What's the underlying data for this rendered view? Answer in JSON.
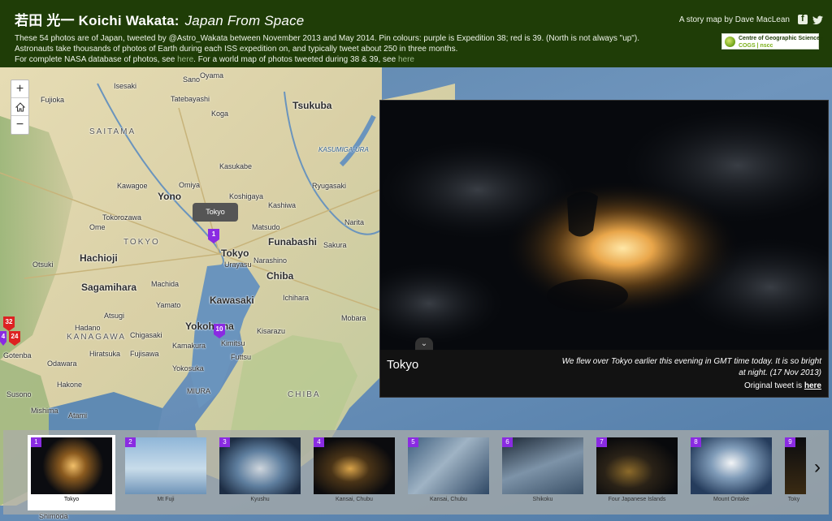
{
  "header": {
    "title_main": "若田 光一 Koichi Wakata:",
    "title_italic": "Japan From Space",
    "description": {
      "line1": "These 54 photos are of Japan, tweeted by @Astro_Wakata between November 2013 and May 2014. Pin colours: purple is Expedition 38; red is 39. (North is not always \"up\").",
      "line2": "Astronauts take thousands of photos of Earth during each ISS expedition on, and typically tweet about 250 in three months.",
      "line3_a": "For complete NASA database of photos, see",
      "line3_link1": "here",
      "line3_b": ". For a world map of photos tweeted during 38 & 39, see",
      "line3_link2": "here"
    },
    "byline": "A story map by Dave MacLean",
    "logo_line1": "Centre of Geographic Sciences",
    "logo_line2": "COGS | nscc"
  },
  "map": {
    "zoom_in": "+",
    "zoom_out": "−",
    "home_icon": "home-icon",
    "tooltip": "Tokyo",
    "labels": [
      {
        "text": "Oyama",
        "cls": ""
      },
      {
        "text": "Tsukuba",
        "cls": ""
      },
      {
        "text": "Koga",
        "cls": ""
      },
      {
        "text": "SAITAMA",
        "cls": "region"
      },
      {
        "text": "KASUMIGA-URA",
        "cls": "lake"
      },
      {
        "text": "Kawagoe",
        "cls": ""
      },
      {
        "text": "Yono",
        "cls": "big"
      },
      {
        "text": "Omiya",
        "cls": ""
      },
      {
        "text": "Kasukabe",
        "cls": ""
      },
      {
        "text": "Koshigaya",
        "cls": ""
      },
      {
        "text": "Ryugasaki",
        "cls": ""
      },
      {
        "text": "Kashiwa",
        "cls": ""
      },
      {
        "text": "Tokorozawa",
        "cls": ""
      },
      {
        "text": "Matsudo",
        "cls": ""
      },
      {
        "text": "Funabashi",
        "cls": "big"
      },
      {
        "text": "Sakura",
        "cls": ""
      },
      {
        "text": "Narita",
        "cls": ""
      },
      {
        "text": "TOKYO",
        "cls": "region"
      },
      {
        "text": "Tokyo",
        "cls": "big"
      },
      {
        "text": "Hachioji",
        "cls": "big"
      },
      {
        "text": "Chiba",
        "cls": "big"
      },
      {
        "text": "Urayasu",
        "cls": ""
      },
      {
        "text": "Narashino",
        "cls": ""
      },
      {
        "text": "Sagamihara",
        "cls": "big"
      },
      {
        "text": "Machida",
        "cls": ""
      },
      {
        "text": "Kawasaki",
        "cls": "big"
      },
      {
        "text": "Yamato",
        "cls": ""
      },
      {
        "text": "Ichihara",
        "cls": ""
      },
      {
        "text": "Mobara",
        "cls": ""
      },
      {
        "text": "KANAGAWA",
        "cls": "region"
      },
      {
        "text": "Yokohama",
        "cls": "big"
      },
      {
        "text": "Atsugi",
        "cls": ""
      },
      {
        "text": "Chigasaki",
        "cls": ""
      },
      {
        "text": "Kisarazu",
        "cls": ""
      },
      {
        "text": "Hiratsuka",
        "cls": ""
      },
      {
        "text": "Fujisawa",
        "cls": ""
      },
      {
        "text": "Kamakura",
        "cls": ""
      },
      {
        "text": "Kimitsu",
        "cls": ""
      },
      {
        "text": "Futtsu",
        "cls": ""
      },
      {
        "text": "Odawara",
        "cls": ""
      },
      {
        "text": "Yokosuka",
        "cls": ""
      },
      {
        "text": "Hakone",
        "cls": ""
      },
      {
        "text": "MIURA",
        "cls": ""
      },
      {
        "text": "CHIBA",
        "cls": "region"
      },
      {
        "text": "Atami",
        "cls": ""
      },
      {
        "text": "Mishima",
        "cls": ""
      },
      {
        "text": "Gotenba",
        "cls": ""
      },
      {
        "text": "Susono",
        "cls": ""
      },
      {
        "text": "Shimoda",
        "cls": ""
      },
      {
        "text": "Fujioka",
        "cls": ""
      },
      {
        "text": "Tatebayashi",
        "cls": ""
      },
      {
        "text": "Isesaki",
        "cls": ""
      },
      {
        "text": "Sano",
        "cls": ""
      },
      {
        "text": "Ome",
        "cls": ""
      },
      {
        "text": "Otsuki",
        "cls": ""
      },
      {
        "text": "Hadano",
        "cls": ""
      }
    ],
    "pins": [
      {
        "num": "1",
        "color": "purple"
      },
      {
        "num": "10",
        "color": "purple"
      },
      {
        "num": "32",
        "color": "red"
      },
      {
        "num": "24",
        "color": "red"
      },
      {
        "num": "4",
        "color": "purple"
      }
    ]
  },
  "photo": {
    "title": "Tokyo",
    "caption": "We flew over Tokyo earlier this evening in GMT time today. It is so bright at night. (17 Nov 2013)",
    "link_prefix": "Original tweet is",
    "link_text": "here"
  },
  "carousel": {
    "items": [
      {
        "num": "1",
        "label": "Tokyo"
      },
      {
        "num": "2",
        "label": "Mt Fuji"
      },
      {
        "num": "3",
        "label": "Kyushu"
      },
      {
        "num": "4",
        "label": "Kansai, Chubu"
      },
      {
        "num": "5",
        "label": "Kansai, Chubu"
      },
      {
        "num": "6",
        "label": "Shikoku"
      },
      {
        "num": "7",
        "label": "Four Japanese Islands"
      },
      {
        "num": "8",
        "label": "Mount Ontake"
      },
      {
        "num": "9",
        "label": "Toky"
      }
    ]
  }
}
